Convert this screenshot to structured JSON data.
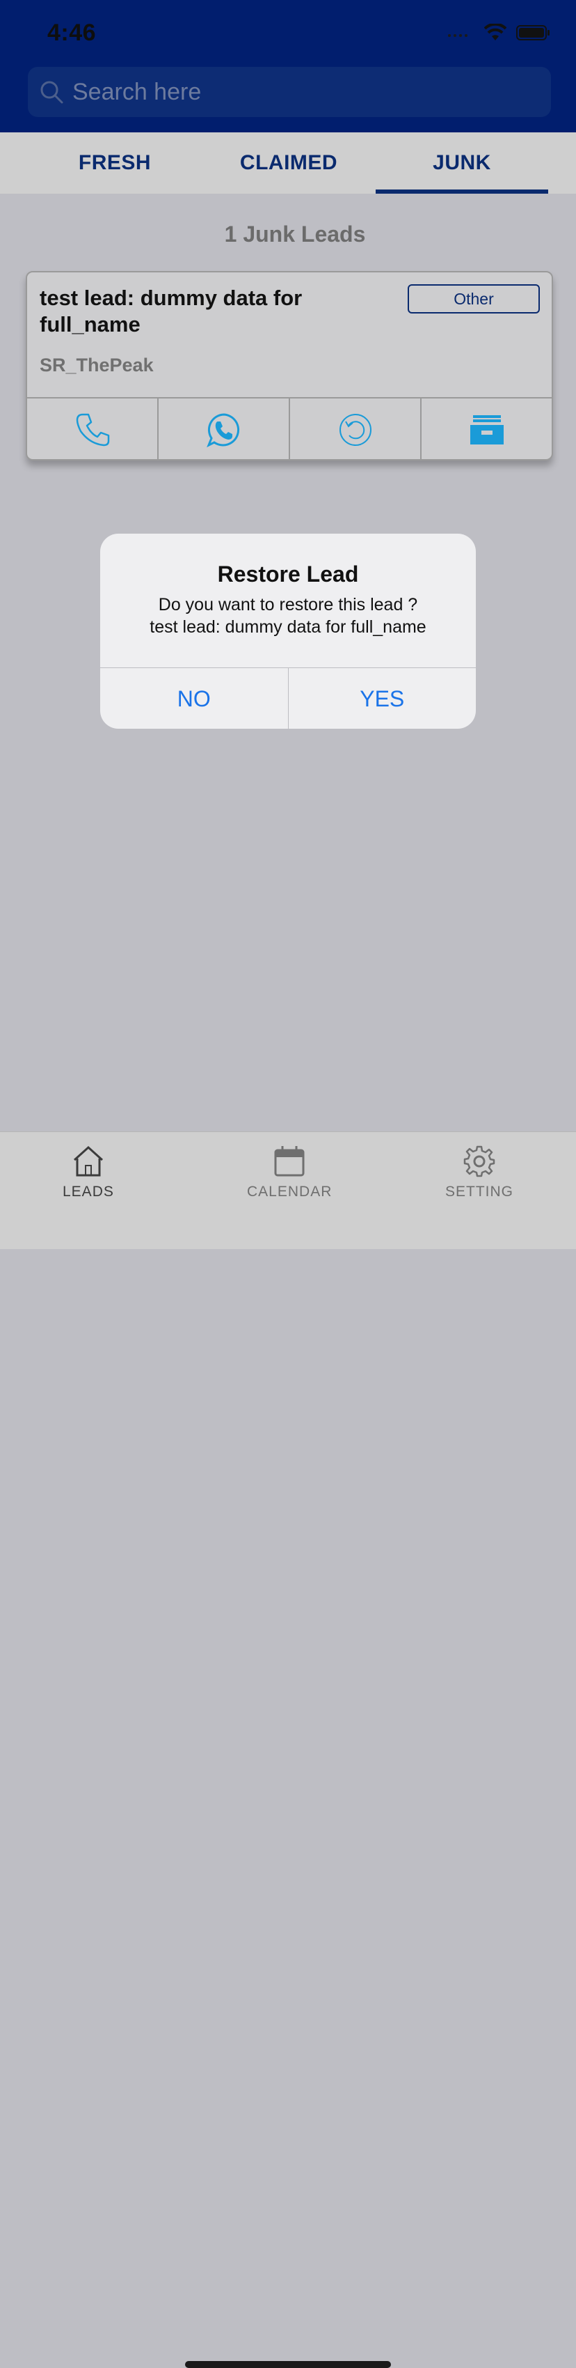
{
  "status_bar": {
    "time": "4:46"
  },
  "search": {
    "placeholder": "Search here"
  },
  "tabs": [
    {
      "label": "FRESH"
    },
    {
      "label": "CLAIMED"
    },
    {
      "label": "JUNK",
      "active": true
    }
  ],
  "count_title": "1 Junk Leads",
  "lead_card": {
    "title": "test lead: dummy data for full_name",
    "badge": "Other",
    "source": "SR_ThePeak",
    "actions": [
      "phone-icon",
      "whatsapp-icon",
      "restore-icon",
      "archive-icon"
    ]
  },
  "dialog": {
    "title": "Restore Lead",
    "message_line1": "Do you want to restore this lead ?",
    "message_line2": "test lead: dummy data for full_name",
    "no_label": "NO",
    "yes_label": "YES"
  },
  "tabbar": {
    "leads": "LEADS",
    "calendar": "CALENDAR",
    "setting": "SETTING"
  },
  "colors": {
    "header": "#011e6e",
    "accent": "#0a2a6e",
    "action_icon": "#1a9bd8",
    "dialog_button": "#1a73e8"
  }
}
